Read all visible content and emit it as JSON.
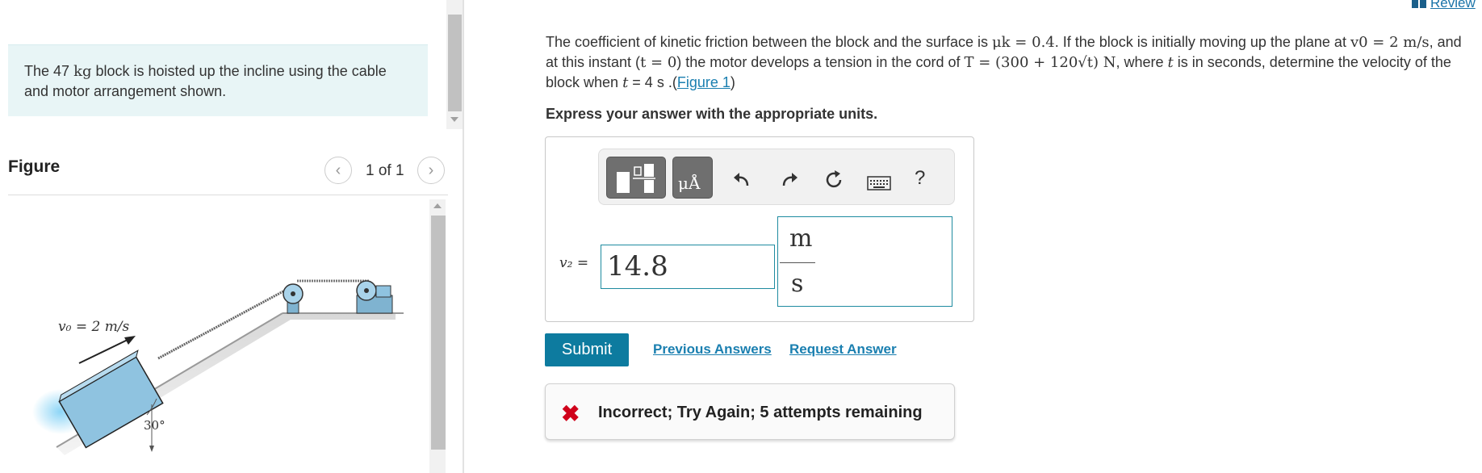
{
  "problem": {
    "text_before": "The 47",
    "mass_unit": "kg",
    "text_after": "block is hoisted up the incline using the cable and motor arrangement shown."
  },
  "figure": {
    "title": "Figure",
    "counter": "1 of 1",
    "prev_icon": "chevron-left-icon",
    "next_icon": "chevron-right-icon",
    "v0_label": "v₀ = 2 m/s",
    "angle_label": "30°"
  },
  "header": {
    "review_link": "Review"
  },
  "question": {
    "t1": "The coefficient of kinetic friction between the block and the surface is ",
    "mu": "μk = 0.4",
    "t2": ". If the block is initially moving up the plane at ",
    "v0": "v0 = 2 m/s",
    "t3": ", and at this instant (",
    "t0": "t = 0",
    "t4": ") the motor develops a tension in the cord of ",
    "tension": "T = (300 + 120√t) N",
    "t5": ", where ",
    "tvar": "t",
    "t6": " is in seconds, determine the velocity of the block when ",
    "tval": "t",
    "t7": " = 4 s .(",
    "figure_link": "Figure 1",
    "t8": ")"
  },
  "instruction": "Express your answer with the appropriate units.",
  "toolbar": {
    "templates_icon": "templates-icon",
    "symbols_icon": "symbols-icon",
    "symbols_label": "μÅ",
    "undo_icon": "undo-icon",
    "redo_icon": "redo-icon",
    "reset_icon": "reset-icon",
    "keyboard_icon": "keyboard-icon",
    "help_label": "?"
  },
  "answer": {
    "variable_label": "v₂ =",
    "value": "14.8",
    "unit_numerator": "m",
    "unit_denominator": "s"
  },
  "actions": {
    "submit": "Submit",
    "previous_answers": "Previous Answers",
    "request_answer": "Request Answer"
  },
  "feedback": {
    "icon": "x-mark-icon",
    "text": "Incorrect; Try Again; 5 attempts remaining"
  },
  "colors": {
    "accent": "#0d7b9f",
    "link": "#1a7fb0",
    "error": "#d0021b",
    "problem_bg": "#e8f5f6"
  }
}
